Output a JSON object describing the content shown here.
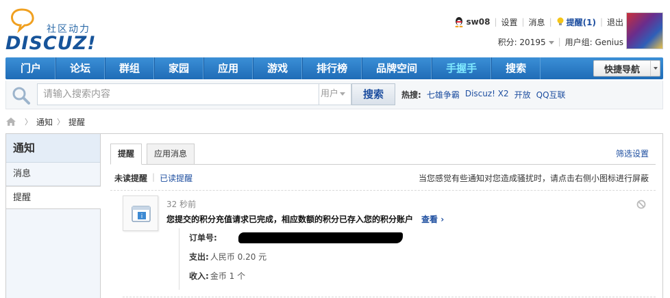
{
  "header": {
    "logo_tag": "社区动力",
    "logo_word": "DISCUZ!",
    "username": "sw08",
    "settings": "设置",
    "messages": "消息",
    "remind": "提醒(1)",
    "logout": "退出",
    "score": "积分: 20195",
    "usergroup": "用户组: Genius"
  },
  "nav": {
    "items": [
      "门户",
      "论坛",
      "群组",
      "家园",
      "应用",
      "游戏",
      "排行榜",
      "品牌空间",
      "手握手",
      "搜索"
    ],
    "quicknav": "快捷导航"
  },
  "search": {
    "placeholder": "请输入搜索内容",
    "type": "用户",
    "button": "搜索",
    "hot_label": "热搜:",
    "hot": [
      "七雄争霸",
      "Discuz! X2",
      "开放",
      "QQ互联"
    ]
  },
  "breadcrumb": [
    "通知",
    "提醒"
  ],
  "sidebar": {
    "title": "通知",
    "items": [
      "消息",
      "提醒"
    ]
  },
  "tabs": [
    "提醒",
    "应用消息"
  ],
  "filter": "筛选设置",
  "subtabs": {
    "unread": "未读提醒",
    "read": "已读提醒"
  },
  "tip": "当您感觉有些通知对您造成骚扰时，请点击右侧小图标进行屏蔽",
  "notice": {
    "time": "32 秒前",
    "message": "您提交的积分充值请求已完成，相应数额的积分已存入您的积分账户",
    "view": "查看 ›",
    "order_label": "订单号:",
    "pay_label": "支出:",
    "pay_value": "人民币 0.20 元",
    "income_label": "收入:",
    "income_value": "金币 1 个"
  },
  "colors": {
    "nav": "#1f6cb7",
    "link": "#1c4d9f",
    "highlight": "#7fe9ff"
  }
}
